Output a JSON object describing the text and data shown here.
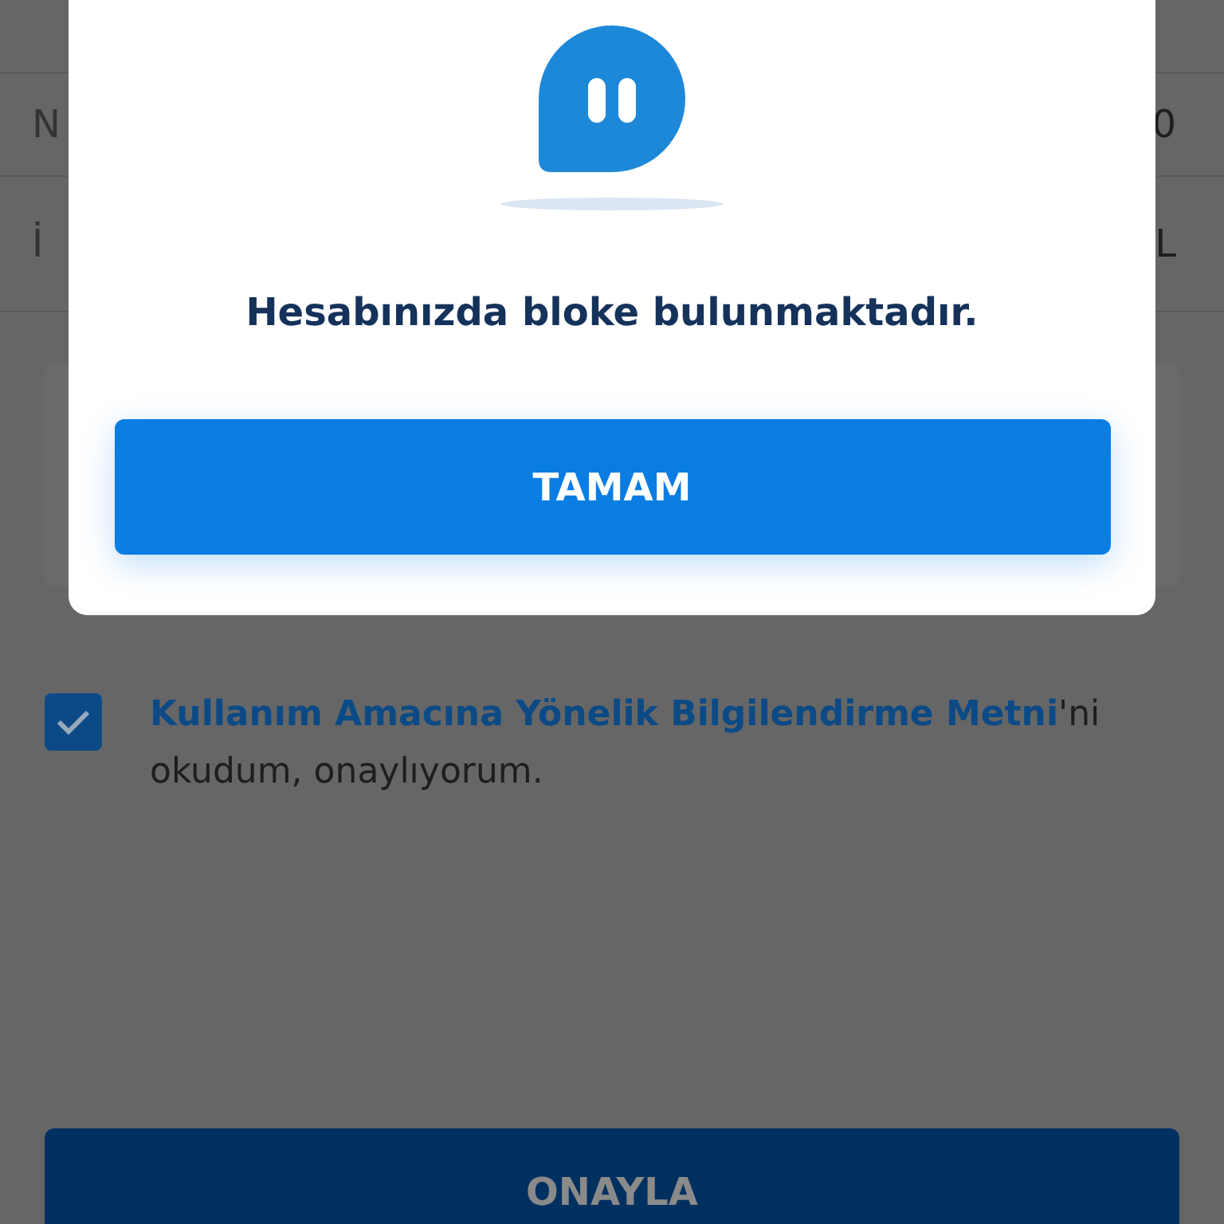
{
  "rows": [
    {
      "label": "N",
      "value": "0"
    },
    {
      "label": "İ",
      "value": "L"
    }
  ],
  "consent": {
    "checked": true,
    "link": "Kullanım Amacına Yönelik Bilgilendirme Metni",
    "text": "'ni okudum, onaylıyorum."
  },
  "confirm_button": "ONAYLA",
  "dialog": {
    "message": "Hesabınızda bloke bulunmaktadır.",
    "button": "TAMAM"
  }
}
